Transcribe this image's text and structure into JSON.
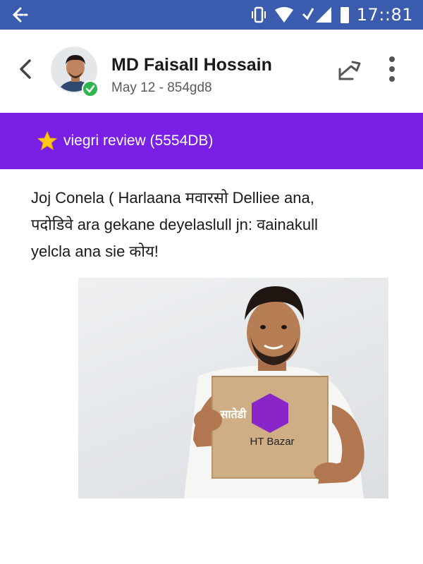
{
  "status_bar": {
    "time": "17::81",
    "back_icon": "back-arrow-icon",
    "icons": [
      "vibrate-icon",
      "wifi-icon",
      "signal-icon",
      "battery-icon"
    ]
  },
  "header": {
    "name": "MD Faisall Hossain",
    "subtitle": "May 12 - 854gd8",
    "verified_icon": "check-icon"
  },
  "banner": {
    "text": "viegri review (5554DB)",
    "icon": "star-icon",
    "color": "#7a1fe6"
  },
  "post": {
    "line1": "Joj Conela ( Harlaana मवारसो Delliee ana,",
    "line2": "पदोडिवे ara gekane deyelaslull jn: वainakull",
    "line3": "yelcla ana sie कोय!"
  },
  "photo": {
    "box_brand": "सातेडी",
    "box_label": "HT Bazar"
  },
  "colors": {
    "status_bar": "#3b5cae",
    "banner": "#7a1fe6",
    "verified": "#2eb54f"
  }
}
